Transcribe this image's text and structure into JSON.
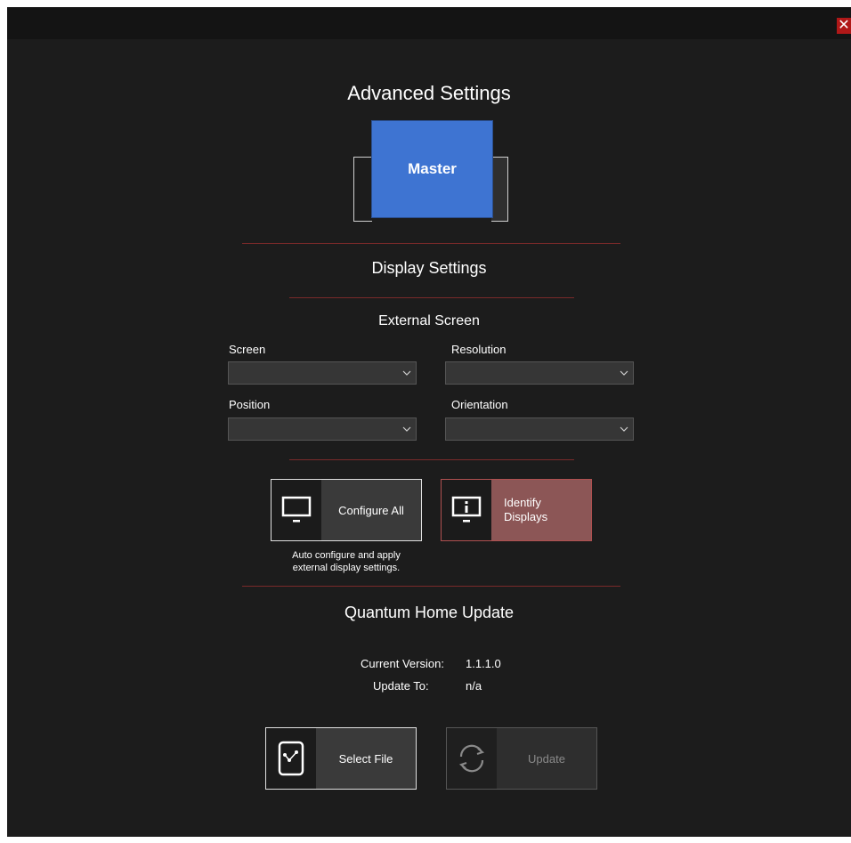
{
  "window": {
    "close_icon": "close-icon",
    "close_glyph": "✕"
  },
  "advanced": {
    "title": "Advanced Settings",
    "master_label": "Master"
  },
  "display_settings": {
    "heading": "Display Settings",
    "external_screen_heading": "External Screen",
    "fields": {
      "screen_label": "Screen",
      "resolution_label": "Resolution",
      "position_label": "Position",
      "orientation_label": "Orientation",
      "screen_value": "",
      "resolution_value": "",
      "position_value": "",
      "orientation_value": ""
    },
    "configure_all": {
      "label": "Configure All",
      "icon": "monitor-icon",
      "description_line1": "Auto configure and apply",
      "description_line2": "external display settings."
    },
    "identify_displays": {
      "label_line1": "Identify",
      "label_line2": "Displays",
      "icon": "monitor-info-icon"
    }
  },
  "update": {
    "heading": "Quantum Home Update",
    "current_version_label": "Current Version:",
    "current_version_value": "1.1.1.0",
    "update_to_label": "Update To:",
    "update_to_value": "n/a",
    "select_file_label": "Select File",
    "select_file_icon": "file-select-icon",
    "update_label": "Update",
    "update_icon": "refresh-icon"
  },
  "colors": {
    "background": "#1c1c1c",
    "master_tile": "#3e74d2",
    "divider": "#7a2a2a",
    "identify_button": "#8c5656",
    "close_button": "#b01818"
  }
}
